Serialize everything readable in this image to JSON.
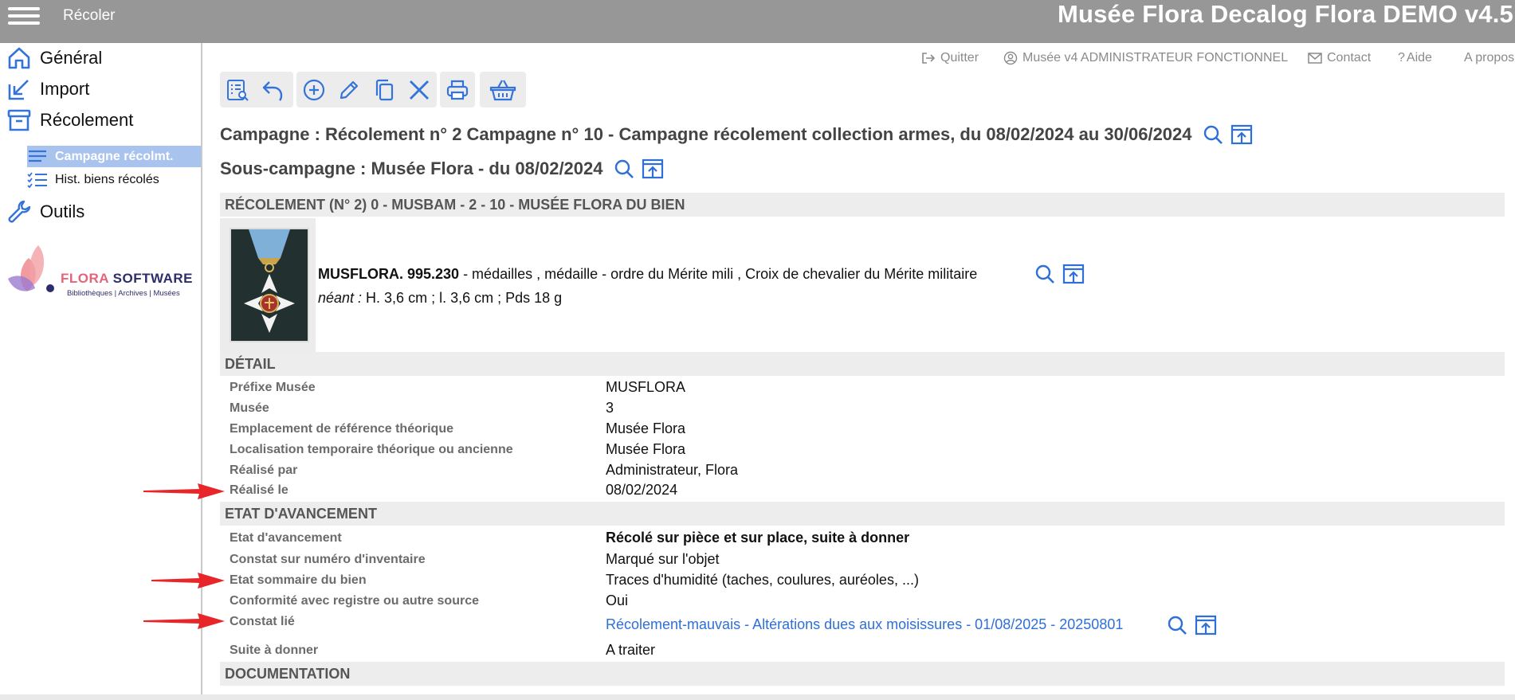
{
  "header": {
    "module_title": "Récoler",
    "app_title": "Musée Flora Decalog Flora DEMO v4.5"
  },
  "sidebar": {
    "items": [
      {
        "label": "Général",
        "icon": "home-icon"
      },
      {
        "label": "Import",
        "icon": "import-arrow-icon"
      },
      {
        "label": "Récolement",
        "icon": "archive-box-icon"
      },
      {
        "label": "Outils",
        "icon": "wrench-icon"
      }
    ],
    "subitems": [
      {
        "label": "Campagne récolmt.",
        "icon": "list-lines-icon",
        "active": true
      },
      {
        "label": "Hist. biens récolés",
        "icon": "checklist-icon",
        "active": false
      }
    ],
    "logo": {
      "brand_flora": "FLORA",
      "brand_software": " SOFTWARE",
      "tagline": "Bibliothèques | Archives | Musées"
    }
  },
  "utility_links": {
    "quit": "Quitter",
    "user": "Musée v4 ADMINISTRATEUR FONCTIONNEL",
    "contact": "Contact",
    "help": "Aide",
    "about": "A propos"
  },
  "toolbar": {
    "groups": [
      [
        "search-list-icon",
        "undo-icon"
      ],
      [
        "add-icon",
        "edit-pencil-icon",
        "copy-icon",
        "delete-x-icon"
      ],
      [
        "print-icon"
      ],
      [
        "basket-icon"
      ]
    ]
  },
  "campaign": {
    "title": "Campagne : Récolement n° 2 Campagne n° 10 - Campagne récolement collection armes, du 08/02/2024 au 30/06/2024"
  },
  "subcampaign": {
    "title": "Sous-campagne : Musée Flora - du 08/02/2024"
  },
  "sections": {
    "recolement": "RÉCOLEMENT (N° 2) 0 - MUSBAM - 2 - 10 - MUSÉE FLORA DU BIEN",
    "detail": "DÉTAIL",
    "etat": "ETAT D'AVANCEMENT",
    "documentation": "DOCUMENTATION"
  },
  "bien": {
    "reference": "MUSFLORA. 995.230",
    "description": " - médailles , médaille - ordre du Mérite mili , Croix de chevalier du Mérite militaire",
    "dims_prefix": "néant :",
    "dims": " H. 3,6 cm ; l. 3,6 cm ; Pds 18  g"
  },
  "detail_fields": [
    {
      "label": "Préfixe Musée",
      "value": "MUSFLORA"
    },
    {
      "label": "Musée",
      "value": "3"
    },
    {
      "label": "Emplacement de référence théorique",
      "value": "Musée Flora"
    },
    {
      "label": "Localisation temporaire théorique ou ancienne",
      "value": "Musée Flora"
    },
    {
      "label": "Réalisé par",
      "value": "Administrateur, Flora"
    },
    {
      "label": "Réalisé le",
      "value": "08/02/2024"
    }
  ],
  "etat_fields": [
    {
      "label": "Etat d'avancement",
      "value": "Récolé sur pièce et sur place, suite à donner"
    },
    {
      "label": "Constat sur numéro d'inventaire",
      "value": "Marqué sur l'objet"
    },
    {
      "label": "Etat sommaire du bien",
      "value": "Traces d'humidité (taches, coulures, auréoles, ...)"
    },
    {
      "label": "Conformité avec registre ou autre source",
      "value": "Oui"
    },
    {
      "label": "Constat lié",
      "value": "Récolement-mauvais - Altérations dues aux moisissures - 01/08/2025 - 20250801"
    },
    {
      "label": "Suite à donner",
      "value": "A traiter"
    }
  ],
  "colors": {
    "header_bg": "#979797",
    "accent_blue": "#2e6fd8",
    "active_nav": "#a9c3ef",
    "arrow_red": "#e8262a"
  }
}
